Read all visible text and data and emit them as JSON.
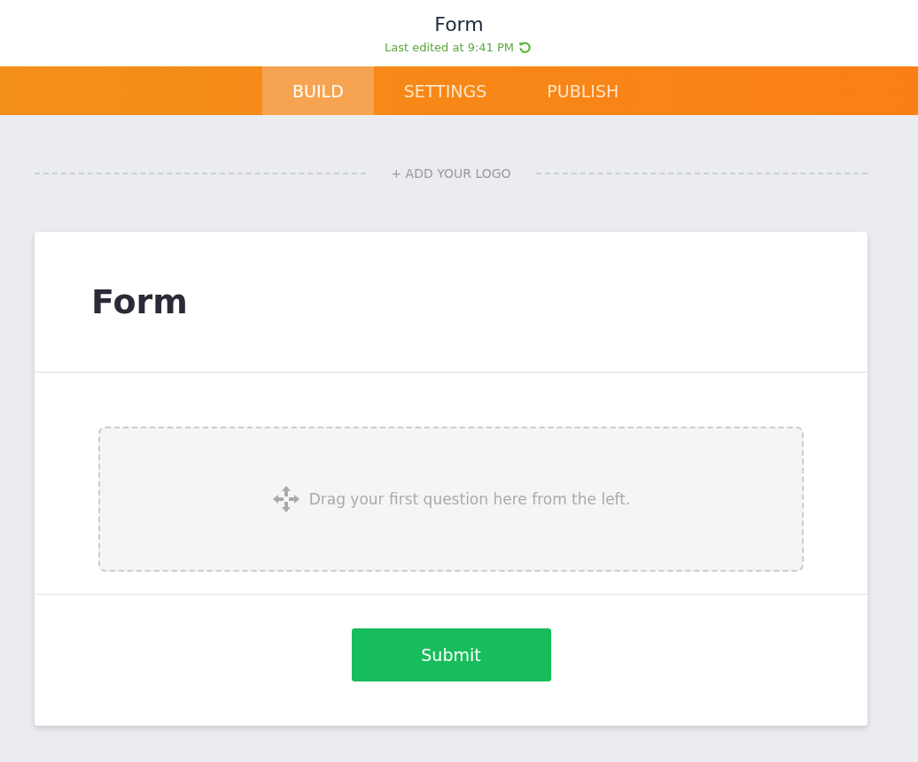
{
  "header": {
    "title": "Form",
    "last_edited": "Last edited at 9:41 PM"
  },
  "tabs": [
    {
      "label": "BUILD",
      "selected": true
    },
    {
      "label": "SETTINGS",
      "selected": false
    },
    {
      "label": "PUBLISH",
      "selected": false
    }
  ],
  "logo_link": "+ ADD YOUR LOGO",
  "form": {
    "title": "Form",
    "drop_hint": "Drag your first question here from the left.",
    "submit": "Submit"
  }
}
